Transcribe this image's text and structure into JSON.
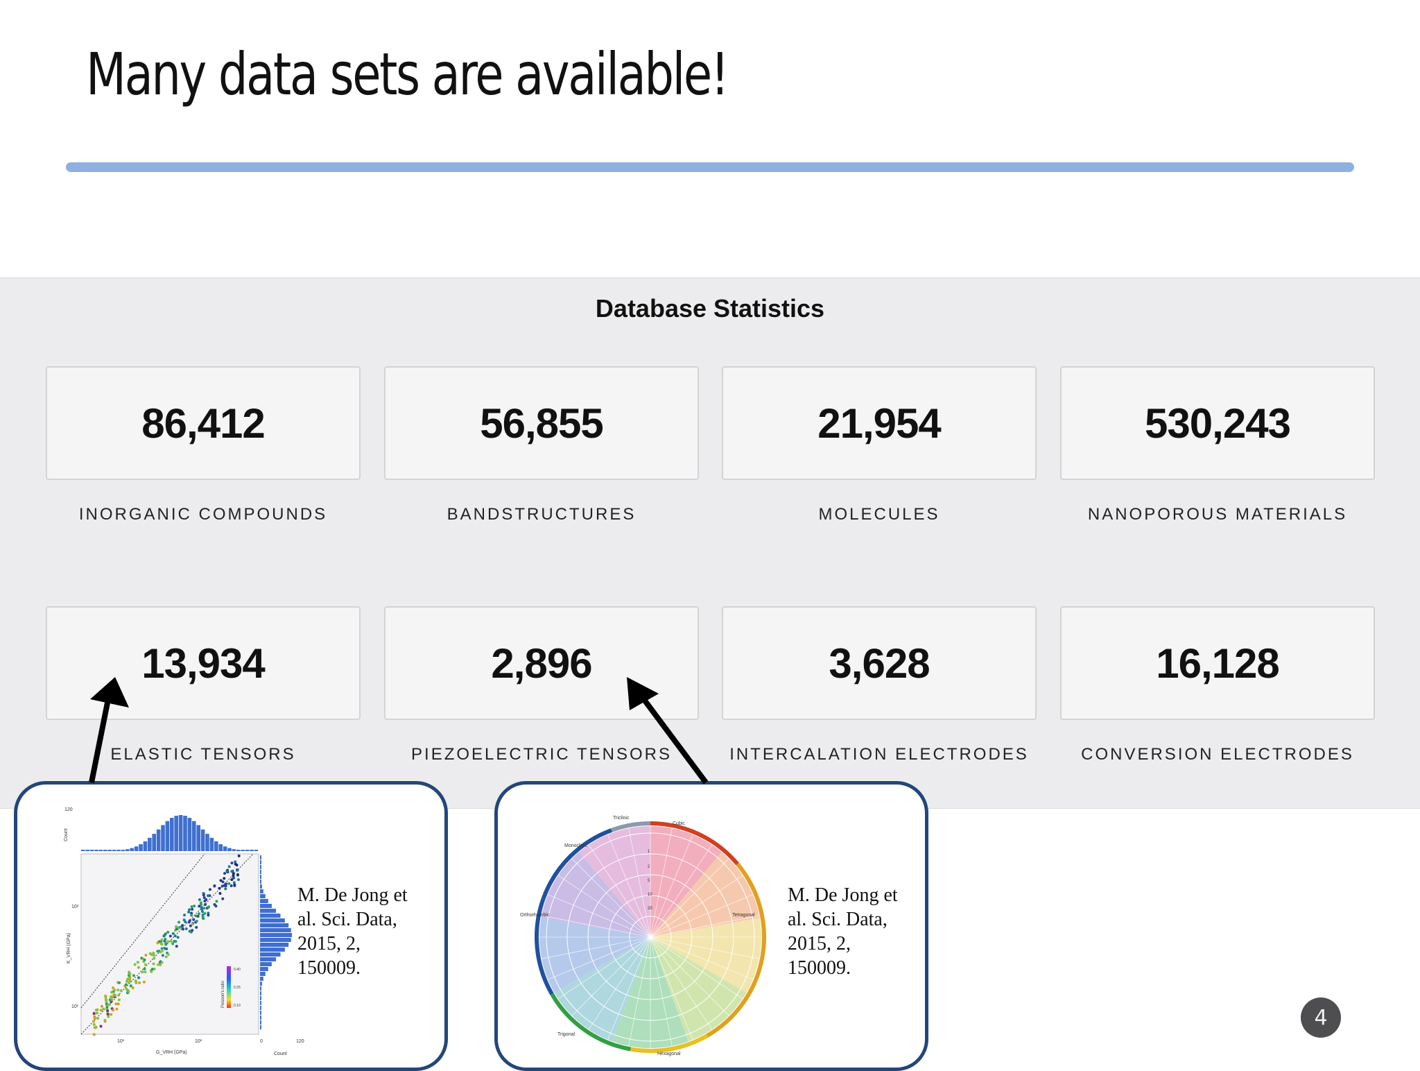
{
  "slide": {
    "title": "Many data sets are available!",
    "page_number": "4"
  },
  "stats": {
    "heading": "Database Statistics",
    "items": [
      {
        "value": "86,412",
        "label": "INORGANIC COMPOUNDS"
      },
      {
        "value": "56,855",
        "label": "BANDSTRUCTURES"
      },
      {
        "value": "21,954",
        "label": "MOLECULES"
      },
      {
        "value": "530,243",
        "label": "NANOPOROUS MATERIALS"
      },
      {
        "value": "13,934",
        "label": "ELASTIC TENSORS"
      },
      {
        "value": "2,896",
        "label": "PIEZOELECTRIC TENSORS"
      },
      {
        "value": "3,628",
        "label": "INTERCALATION ELECTRODES"
      },
      {
        "value": "16,128",
        "label": "CONVERSION ELECTRODES"
      }
    ]
  },
  "elastic_figure": {
    "citation": "M. De Jong et al. Sci. Data, 2015, 2, 150009.",
    "top_hist_ymax": "120",
    "top_hist_ylabel": "Count",
    "x_label": "G_VRH (GPa)",
    "y_label": "K_VRH (GPa)",
    "x_ticks": [
      "10¹",
      "10²"
    ],
    "y_ticks": [
      "10²",
      "10¹"
    ],
    "side_hist_xticks": [
      "0",
      "120"
    ],
    "side_hist_xlabel": "Count",
    "colorbar_label": "Poisson's ratio",
    "colorbar_ticks": [
      "0.40",
      "0.25",
      "0.10"
    ]
  },
  "piezo_figure": {
    "citation": "M. De Jong et al. Sci. Data, 2015, 2, 150009.",
    "crystal_systems": [
      "Triclinic",
      "Cubic",
      "Monoclinic",
      "Orthorhombic",
      "Tetragonal",
      "Trigonal",
      "Hexagonal"
    ],
    "radial_ticks": [
      "1",
      "2",
      "5",
      "10",
      "20"
    ]
  },
  "colors": {
    "title_rule": "#8eb0e0",
    "card_border": "#23467a",
    "panel_bg": "#ececee"
  }
}
